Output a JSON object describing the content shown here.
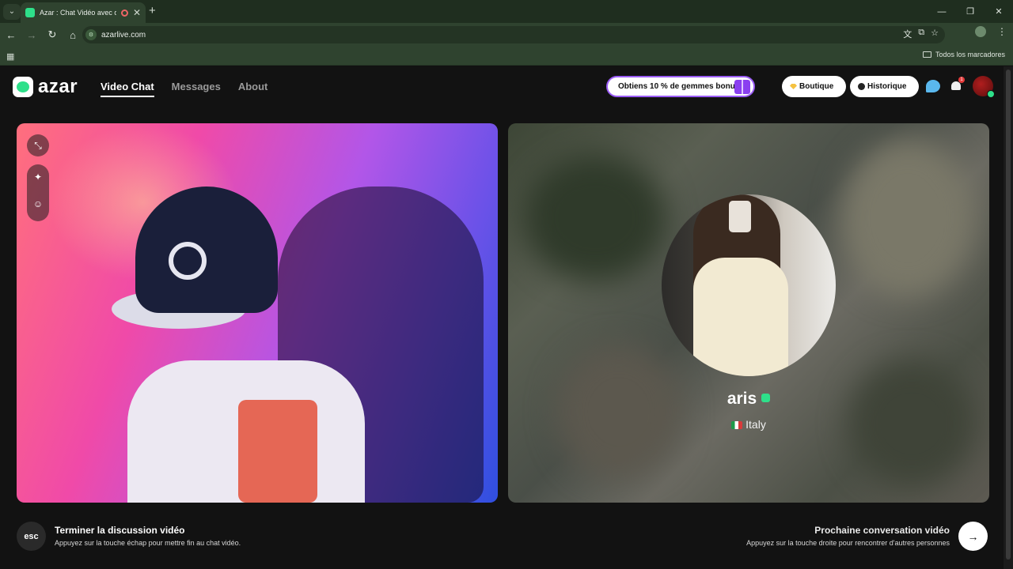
{
  "browser": {
    "tab_title": "Azar : Chat Vidéo avec de n",
    "url": "azarlive.com",
    "all_bookmarks": "Todos los marcadores",
    "window_controls": [
      "—",
      "❐",
      "✕"
    ]
  },
  "header": {
    "logo_text": "azar",
    "nav": [
      {
        "label": "Video Chat",
        "active": true
      },
      {
        "label": "Messages",
        "active": false
      },
      {
        "label": "About",
        "active": false
      }
    ],
    "bonus_label": "Obtiens 10 % de gemmes bonus !",
    "boutique_label": "Boutique",
    "historique_label": "Historique",
    "notification_count": "1"
  },
  "peer": {
    "name": "aris",
    "country": "Italy"
  },
  "footer": {
    "esc_label": "esc",
    "end_title": "Terminer la discussion vidéo",
    "end_sub": "Appuyez sur la touche échap pour mettre fin au chat vidéo.",
    "next_title": "Prochaine conversation vidéo",
    "next_sub": "Appuyez sur la touche droite pour rencontrer d'autres personnes"
  },
  "colors": {
    "accent": "#2ee08a",
    "bonus_border": "#9b5cf6",
    "browser_chrome": "#2f432f"
  },
  "icons": [
    "tab-list-icon",
    "close-tab-icon",
    "new-tab-icon",
    "back-icon",
    "forward-icon",
    "reload-icon",
    "home-icon",
    "translate-icon",
    "install-icon",
    "bookmark-star-icon",
    "profile-icon",
    "menu-icon",
    "apps-icon",
    "folder-icon",
    "gift-icon",
    "gem-icon",
    "clock-icon",
    "chat-icon",
    "bell-icon",
    "minimize-video-icon",
    "magic-wand-icon",
    "sticker-icon",
    "verified-icon",
    "flag-italy-icon",
    "next-arrow-icon"
  ]
}
